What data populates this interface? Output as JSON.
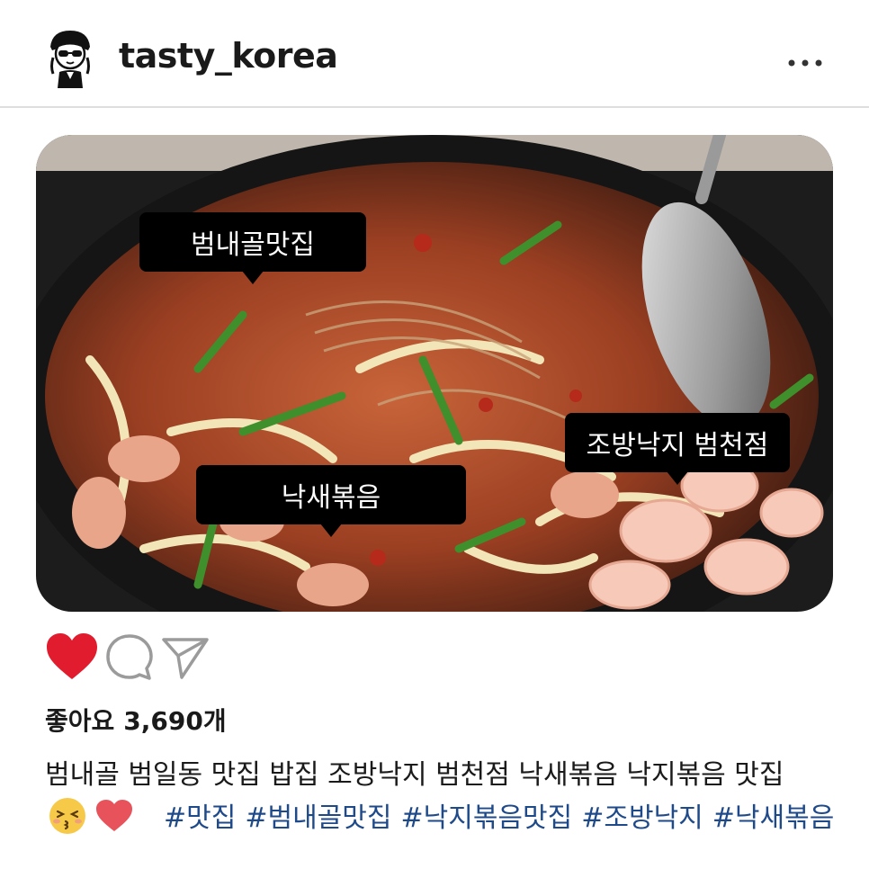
{
  "header": {
    "username": "tasty_korea",
    "avatar_icon": "cartoon-avatar-icon",
    "more_icon": "more-options-icon"
  },
  "photo": {
    "labels": [
      "범내골맛집",
      "조방낙지 범천점",
      "낙새볶음"
    ]
  },
  "actions": {
    "like_icon": "heart-filled-icon",
    "comment_icon": "comment-icon",
    "share_icon": "send-icon",
    "like_color": "#e01c2e"
  },
  "likes": {
    "label": "좋아요",
    "count": "3,690개"
  },
  "caption": {
    "text": "범내골 범일동 맛집 밥집 조방낙지 범천점 낙새볶음 낙지볶음 맛집"
  },
  "emojis": [
    "kissing-face-emoji",
    "red-heart-emoji"
  ],
  "hashtags": [
    "#맛집",
    "#범내골맛집",
    "#낙지볶음맛집",
    "#조방낙지",
    "#낙새볶음"
  ],
  "colors": {
    "hashtag": "#1f4a8a",
    "divider": "#dedede"
  }
}
